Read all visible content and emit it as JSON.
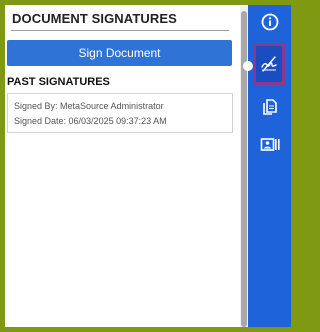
{
  "panel": {
    "title": "DOCUMENT SIGNATURES",
    "sign_button_label": "Sign Document",
    "past_title": "PAST SIGNATURES",
    "signatures": [
      {
        "signed_by": "Signed By: MetaSource Administrator",
        "signed_date": "Signed Date: 06/03/2025 09:37:23 AM"
      }
    ]
  },
  "rail": {
    "items": [
      {
        "icon": "info-icon"
      },
      {
        "icon": "signature-icon"
      },
      {
        "icon": "documents-icon"
      },
      {
        "icon": "contact-card-icon"
      }
    ]
  },
  "colors": {
    "accent": "#2f73d6",
    "rail": "#1e63d9",
    "rail_active": "#1a4ec0",
    "active_outline": "#8a3a8e",
    "frame": "#7f9a12"
  }
}
